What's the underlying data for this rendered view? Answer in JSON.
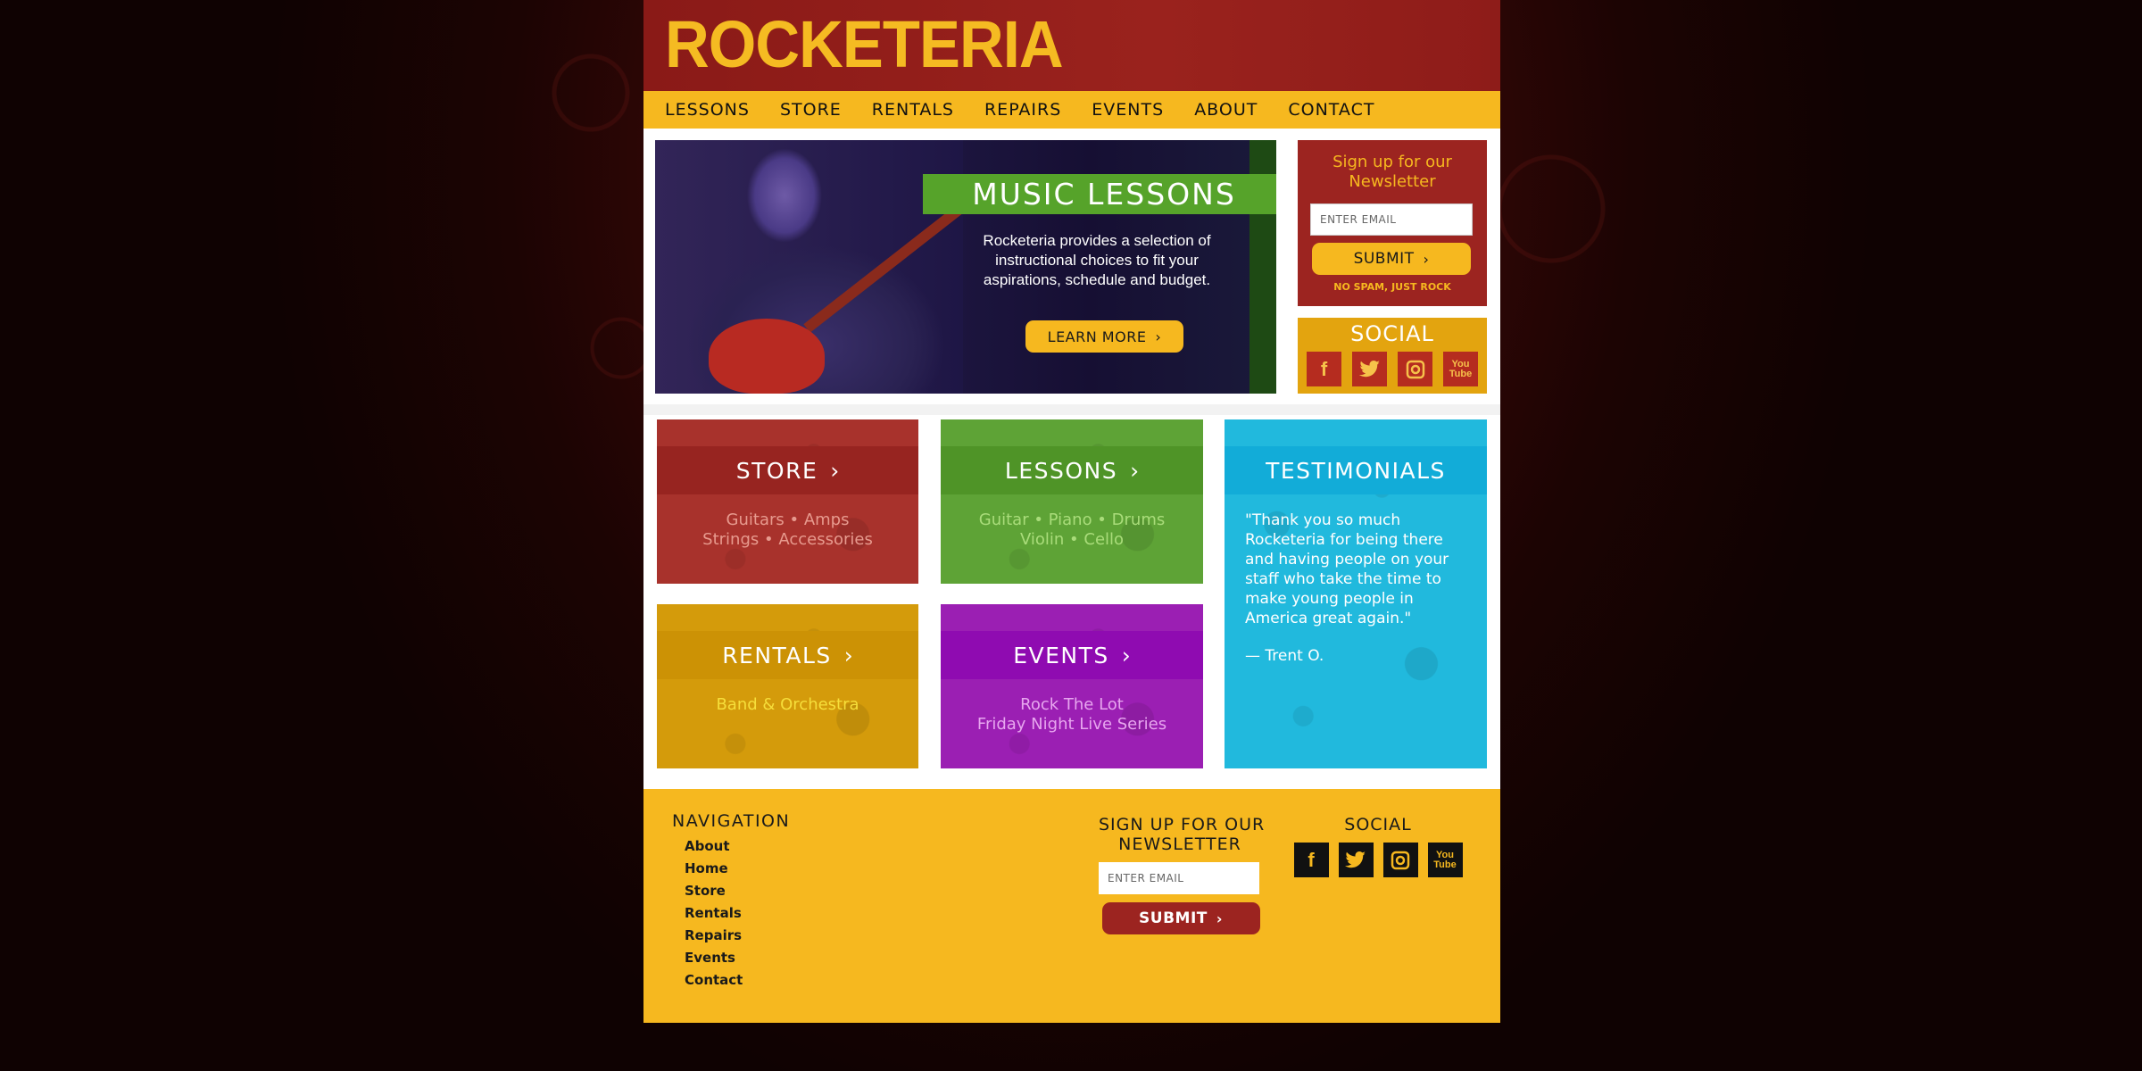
{
  "header": {
    "logo_text": "ROCKETERIA"
  },
  "nav": {
    "items": [
      {
        "label": "LESSONS"
      },
      {
        "label": "STORE"
      },
      {
        "label": "RENTALS"
      },
      {
        "label": "REPAIRS"
      },
      {
        "label": "EVENTS"
      },
      {
        "label": "ABOUT"
      },
      {
        "label": "CONTACT"
      }
    ]
  },
  "hero": {
    "title": "MUSIC LESSONS",
    "text": "Rocketeria provides a selection of instructional choices to fit your aspirations, schedule and budget.",
    "cta_label": "LEARN MORE",
    "cta_icon": "chevron-right-icon"
  },
  "newsletter": {
    "title": "Sign up for our Newsletter",
    "email_placeholder": "ENTER EMAIL",
    "submit_label": "SUBMIT",
    "note": "NO SPAM, JUST ROCK"
  },
  "social": {
    "title": "SOCIAL",
    "icons": [
      "facebook-icon",
      "twitter-icon",
      "instagram-icon",
      "youtube-icon"
    ],
    "youtube_glyph_top": "You",
    "youtube_glyph_bottom": "Tube"
  },
  "tiles": {
    "store": {
      "title": "STORE",
      "line1": "Guitars • Amps",
      "line2": "Strings • Accessories",
      "color": "#a8322c"
    },
    "lessons": {
      "title": "LESSONS",
      "line1": "Guitar • Piano • Drums",
      "line2": "Violin • Cello",
      "color": "#5ea336"
    },
    "testimonials": {
      "title": "TESTIMONIALS",
      "quote": "\"Thank you so much Rocketeria for being there and having people on your staff who take the time to make young people in America great again.\"",
      "author": "— Trent O.",
      "color": "#21b9dd"
    },
    "rentals": {
      "title": "RENTALS",
      "line1": "Band & Orchestra",
      "color": "#d49b0b"
    },
    "events": {
      "title": "EVENTS",
      "line1": "Rock The Lot",
      "line2": "Friday Night Live Series",
      "color": "#9b1fb3"
    }
  },
  "footer": {
    "nav_title": "NAVIGATION",
    "nav_items": [
      "About",
      "Home",
      "Store",
      "Rentals",
      "Repairs",
      "Events",
      "Contact"
    ],
    "newsletter_title_line1": "SIGN UP FOR OUR",
    "newsletter_title_line2": "NEWSLETTER",
    "email_placeholder": "ENTER EMAIL",
    "submit_label": "SUBMIT",
    "social_title": "SOCIAL"
  },
  "colors": {
    "header_red": "#9a221d",
    "accent_yellow": "#f6b81f",
    "green": "#56a32a",
    "cyan": "#21b9dd",
    "purple": "#9b1fb3"
  }
}
